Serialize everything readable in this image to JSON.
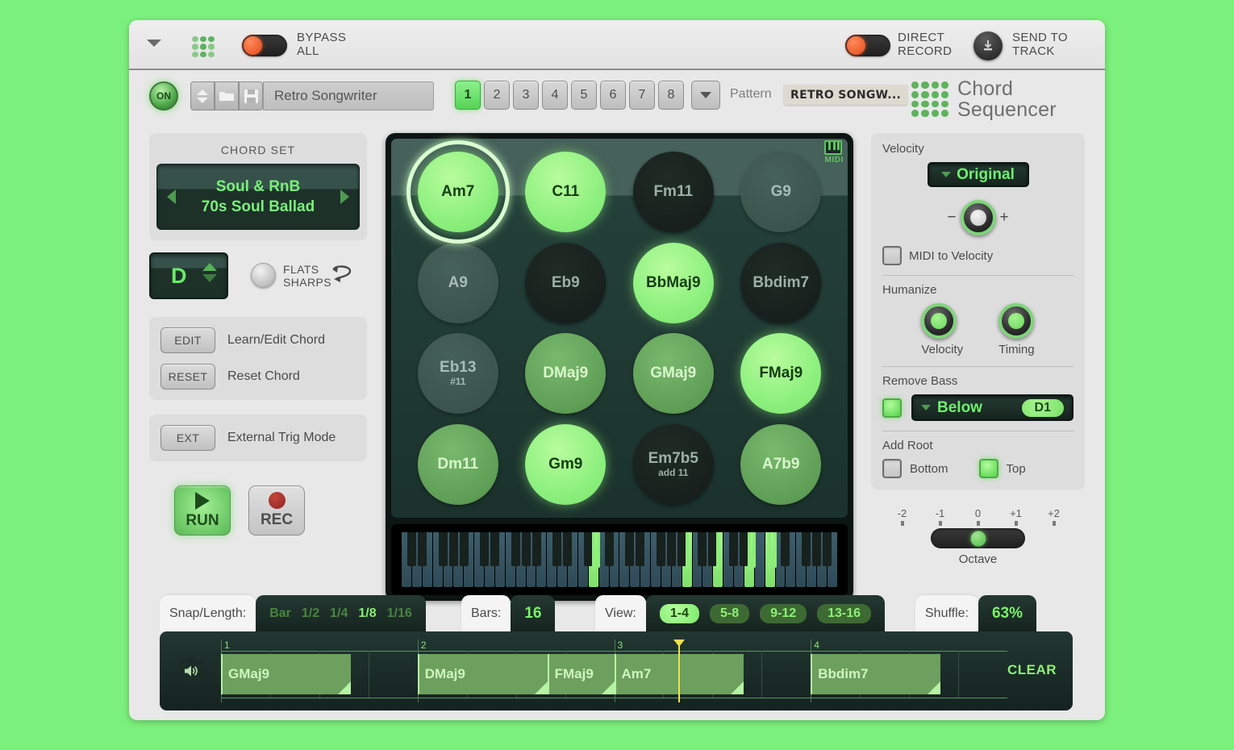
{
  "host": {
    "collapse_icon": "triangle-down-icon",
    "bypass_label": "BYPASS\nALL",
    "bypass_line1": "BYPASS",
    "bypass_line2": "ALL",
    "direct_line1": "DIRECT",
    "direct_line2": "RECORD",
    "send_line1": "SEND TO",
    "send_line2": "TRACK"
  },
  "preset": {
    "on_label": "ON",
    "name": "Retro Songwriter",
    "pattern_word": "Pattern",
    "pattern_chip": "RETRO SONGW...",
    "patterns": [
      "1",
      "2",
      "3",
      "4",
      "5",
      "6",
      "7",
      "8"
    ],
    "active_pattern": "1",
    "brand_line1": "Chord",
    "brand_line2": "Sequencer"
  },
  "chordset": {
    "title": "CHORD SET",
    "category": "Soul & RnB",
    "preset": "70s Soul Ballad"
  },
  "key": {
    "letter": "D",
    "flats_line1": "FLATS",
    "flats_line2": "SHARPS"
  },
  "edit": {
    "edit_btn": "EDIT",
    "edit_text": "Learn/Edit Chord",
    "reset_btn": "RESET",
    "reset_text": "Reset Chord",
    "ext_btn": "EXT",
    "ext_text": "External Trig Mode"
  },
  "transport": {
    "run": "RUN",
    "rec": "REC"
  },
  "pads": {
    "midi_badge": "MIDI",
    "items": [
      {
        "name": "Am7",
        "ext": "",
        "style": "bright",
        "selected": true
      },
      {
        "name": "C11",
        "ext": "",
        "style": "bright",
        "selected": false
      },
      {
        "name": "Fm11",
        "ext": "",
        "style": "dark",
        "selected": false
      },
      {
        "name": "G9",
        "ext": "",
        "style": "dim",
        "selected": false
      },
      {
        "name": "A9",
        "ext": "",
        "style": "dim",
        "selected": false
      },
      {
        "name": "Eb9",
        "ext": "",
        "style": "dark",
        "selected": false
      },
      {
        "name": "BbMaj9",
        "ext": "",
        "style": "bright",
        "selected": false
      },
      {
        "name": "Bbdim7",
        "ext": "",
        "style": "dark",
        "selected": false
      },
      {
        "name": "Eb13",
        "ext": "#11",
        "style": "dim",
        "selected": false
      },
      {
        "name": "DMaj9",
        "ext": "",
        "style": "mid",
        "selected": false
      },
      {
        "name": "GMaj9",
        "ext": "",
        "style": "mid",
        "selected": false
      },
      {
        "name": "FMaj9",
        "ext": "",
        "style": "bright",
        "selected": false
      },
      {
        "name": "Dm11",
        "ext": "",
        "style": "mid",
        "selected": false
      },
      {
        "name": "Gm9",
        "ext": "",
        "style": "bright",
        "selected": false
      },
      {
        "name": "Em7b5",
        "ext": "add 11",
        "style": "dark",
        "selected": false
      },
      {
        "name": "A7b9",
        "ext": "",
        "style": "mid",
        "selected": false
      }
    ]
  },
  "keyboard": {
    "lit_white_keys": [
      18,
      27,
      30,
      33,
      35
    ]
  },
  "right": {
    "velocity_label": "Velocity",
    "velocity_mode": "Original",
    "minus": "−",
    "plus": "+",
    "midi_to_velocity": "MIDI to Velocity",
    "midi_to_velocity_on": false,
    "humanize_label": "Humanize",
    "humanize_velocity": "Velocity",
    "humanize_timing": "Timing",
    "remove_bass_label": "Remove Bass",
    "remove_bass_on": true,
    "remove_bass_mode": "Below",
    "remove_bass_note": "D1",
    "add_root_label": "Add Root",
    "add_root_bottom": "Bottom",
    "add_root_bottom_on": false,
    "add_root_top": "Top",
    "add_root_top_on": true,
    "octave_label": "Octave",
    "octave_ticks": [
      "-2",
      "-1",
      "0",
      "+1",
      "+2"
    ],
    "octave_value": "0"
  },
  "bottom": {
    "snap_label": "Snap/Length:",
    "snap_options": [
      "Bar",
      "1/2",
      "1/4",
      "1/8",
      "1/16"
    ],
    "snap_active": "1/8",
    "bars_label": "Bars:",
    "bars_value": "16",
    "view_label": "View:",
    "view_options": [
      "1-4",
      "5-8",
      "9-12",
      "13-16"
    ],
    "view_active": "1-4",
    "shuffle_label": "Shuffle:",
    "shuffle_value": "63%",
    "clear_label": "CLEAR",
    "bar_numbers": [
      "1",
      "2",
      "3",
      "4"
    ],
    "clips": [
      {
        "label": "GMaj9",
        "start": 0.0,
        "length": 0.165
      },
      {
        "label": "DMaj9",
        "start": 0.25,
        "length": 0.165
      },
      {
        "label": "FMaj9",
        "start": 0.415,
        "length": 0.085
      },
      {
        "label": "Am7",
        "start": 0.5,
        "length": 0.165
      },
      {
        "label": "Bbdim7",
        "start": 0.75,
        "length": 0.165
      }
    ],
    "playhead": 0.582
  },
  "colors": {
    "accent_green": "#7cf06a",
    "bright_pad": "#8df07e",
    "panel_gray": "#dddddd",
    "dark_bg": "#1b322c",
    "record_red": "#e24a1a",
    "playhead_yellow": "#efe24a"
  }
}
